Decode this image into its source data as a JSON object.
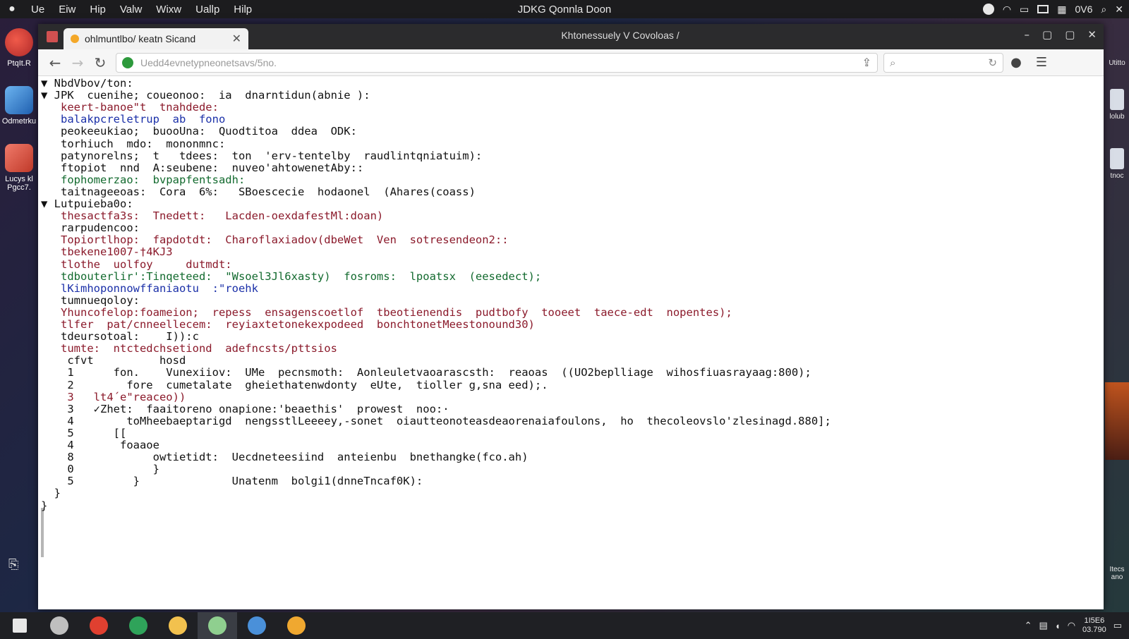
{
  "menubar": {
    "items": [
      "Ue",
      "Eiw",
      "Hip",
      "Valw",
      "Wixw",
      "Uallp",
      "Hilp"
    ],
    "title": "JDKG Qonnla Doon",
    "right_text": "0V6"
  },
  "desktop": {
    "left_icons": [
      {
        "label": "PtqIt.R"
      },
      {
        "label": "Odmetrku"
      },
      {
        "label": "Lucys kl Pgcc7."
      }
    ],
    "right_icons": [
      {
        "label": "Utitto"
      },
      {
        "label": "lolub"
      },
      {
        "label": "tnoc"
      },
      {
        "label": "Itecs ano"
      }
    ]
  },
  "browser": {
    "tab_label": "ohlmuntlbo/ keatn Sicand",
    "window_title": "Khtonessuely V Covoloas /",
    "url": "Uedd4evnetypneonetsavs/5no.",
    "colors": {
      "tab_dot": "#f4a829",
      "lock": "#2d9a3c"
    }
  },
  "code": {
    "lines": [
      {
        "text": "▼ NbdVbov/ton:",
        "color": "#111111"
      },
      {
        "text": "▼ JPK  cuenihe; coueonoo:  ia  dnarntidun(abnie ):",
        "color": "#111111"
      },
      {
        "text": "   keert-banoe\"t  tnahdede:",
        "color": "#8b1a2b"
      },
      {
        "text": "   balakpcreletrup  ab  fono",
        "color": "#1a2fa8"
      },
      {
        "text": "   peokeeukiao;  buooUna:  Quodtitoa  ddea  ODK:",
        "color": "#111111"
      },
      {
        "text": "   torhiuch  mdo:  mononmnc:",
        "color": "#111111"
      },
      {
        "text": "   patynorelns;  t   tdees:  ton  'erv-tentelby  raudlintqniatuim):",
        "color": "#111111"
      },
      {
        "text": "   ftopiot  nnd  A:seubene:  nuveo'ahtowenetAby::",
        "color": "#111111"
      },
      {
        "text": "   fophomerzao:  bvpapfentsadh:",
        "color": "#126a2e"
      },
      {
        "text": "   taitnageeoas:  Cora  6%:   SBoescecie  hodaonel  (Ahares(coass)",
        "color": "#111111"
      },
      {
        "text": "▼ Lutpuieba0o:",
        "color": "#111111"
      },
      {
        "text": "   thesactfa3s:  Tnedett:   Lacden-oexdafestMl:doan)",
        "color": "#8b1a2b"
      },
      {
        "text": "   rarpudencoo:",
        "color": "#111111"
      },
      {
        "text": "   Topiortlhop:  fapdotdt:  Charoflaxiadov(dbeWet  Ven  sotresendeon2::",
        "color": "#8b1a2b"
      },
      {
        "text": "   tbekene1007-†4KJ3",
        "color": "#8b1a2b"
      },
      {
        "text": "   tlothe  uolfoy     dutmdt:",
        "color": "#8b1a2b"
      },
      {
        "text": "   tdbouterlir':Tinqeteed:  \"Wsoel3Jl6xasty)  fosroms:  lpoatsx  (eesedect);",
        "color": "#126a2e"
      },
      {
        "text": "   lKimhoponnowffaniaotu  :\"roehk",
        "color": "#1a2fa8"
      },
      {
        "text": "   tumnueqoloy:",
        "color": "#111111"
      },
      {
        "text": "   Yhuncofelop:foameion;  repess  ensagenscoetlof  tbeotienendis  pudtbofy  tooeet  taece-edt  nopentes);",
        "color": "#8b1a2b"
      },
      {
        "text": "   tlfer  pat/cnneellecem:  reyiaxtetonekexpodeed  bonchtonetMeestonound30)",
        "color": "#8b1a2b"
      },
      {
        "text": "   tdeursotoal:    I)):c",
        "color": "#111111"
      },
      {
        "text": "   tumte:  ntctedchsetiond  adefncsts/pttsios",
        "color": "#8b1a2b"
      },
      {
        "text": "    cfvt          hosd",
        "color": "#111111"
      },
      {
        "text": "    1      fon.    Vunexiiov:  UMe  pecnsmoth:  Aonleuletvaoarascsth:  reaoas  ((UO2beplliage  wihosfiuasrayaag:800);",
        "color": "#111111"
      },
      {
        "text": "    2        fore  cumetalate  gheiethatenwdonty  eUte,  tioller g,sna eed);.",
        "color": "#111111"
      },
      {
        "text": "    3   lt4´e\"reaceo))",
        "color": "#8b1a2b"
      },
      {
        "text": "    3   ✓Zhet:  faaitoreno onapione:'beaethis'  prowest  noo:·",
        "color": "#111111"
      },
      {
        "text": "    4        toMheebaeptarigd  nengsstlLeeeey,-sonet  oiautteonoteasdeaorenaiafoulons,  ho  thecoleovslo'zlesinagd.880];",
        "color": "#111111"
      },
      {
        "text": "    5      [[",
        "color": "#111111"
      },
      {
        "text": "    4       foaaoe",
        "color": "#111111"
      },
      {
        "text": "    8            owtietidt:  Uecdneteesiind  anteienbu  bnethangke(fco.ah)",
        "color": "#111111"
      },
      {
        "text": "    0            }",
        "color": "#111111"
      },
      {
        "text": "    5         }              Unatenm  bolgi1(dnneTncaf0K):",
        "color": "#111111"
      },
      {
        "text": "  }",
        "color": "#111111"
      },
      {
        "text": "}",
        "color": "#111111"
      }
    ]
  },
  "taskbar": {
    "clock_time": "1I5E6",
    "clock_date": "03.790",
    "apps": [
      {
        "name": "windows-start-icon",
        "color": "#e8e8e8"
      },
      {
        "name": "cortana-icon",
        "color": "#bfbfbf"
      },
      {
        "name": "chrome-icon",
        "color": "#e04030"
      },
      {
        "name": "edge-icon",
        "color": "#2fa35a"
      },
      {
        "name": "folder-icon",
        "color": "#f2c14e"
      },
      {
        "name": "notes-icon",
        "color": "#8fcf8f"
      },
      {
        "name": "explorer-icon",
        "color": "#4a90d9"
      },
      {
        "name": "pin-app-icon",
        "color": "#f0a830"
      }
    ]
  }
}
